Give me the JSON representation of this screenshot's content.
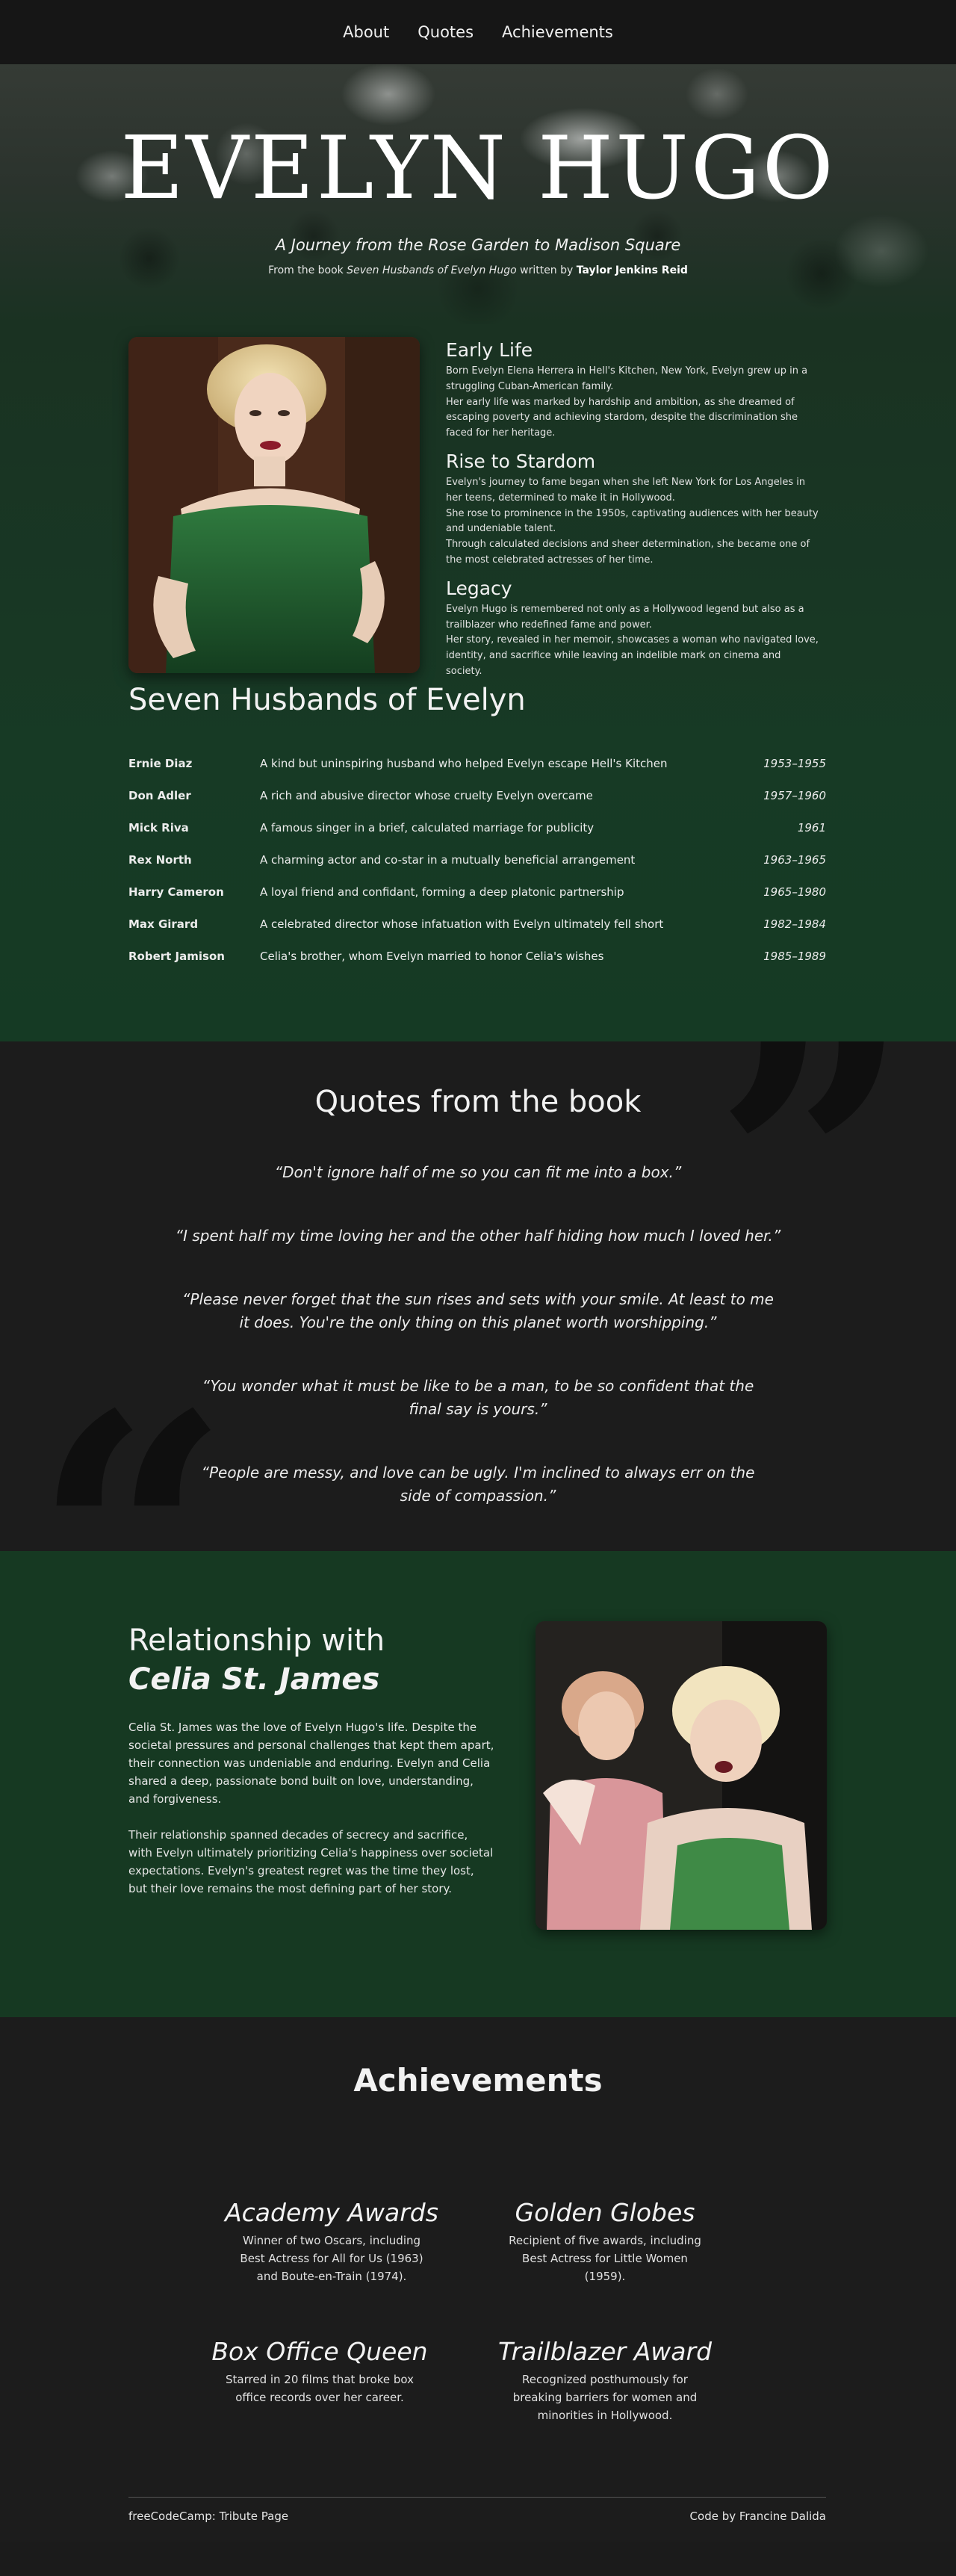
{
  "nav": {
    "items": [
      "About",
      "Quotes",
      "Achievements"
    ]
  },
  "hero": {
    "title": "EVELYN HUGO",
    "subtitle": "A Journey from the Rose Garden to Madison Square",
    "credit_prefix": "From the book ",
    "credit_book": "Seven Husbands of Evelyn Hugo",
    "credit_mid": " written by ",
    "credit_author": "Taylor Jenkins Reid"
  },
  "bio": {
    "sections": [
      {
        "heading": "Early Life",
        "paragraphs": [
          "Born Evelyn Elena Herrera in Hell's Kitchen, New York, Evelyn grew up in a struggling Cuban-American family.",
          "Her early life was marked by hardship and ambition, as she dreamed of escaping poverty and achieving stardom, despite the discrimination she faced for her heritage."
        ]
      },
      {
        "heading": "Rise to Stardom",
        "paragraphs": [
          "Evelyn's journey to fame began when she left New York for Los Angeles in her teens, determined to make it in Hollywood.",
          "She rose to prominence in the 1950s, captivating audiences with her beauty and undeniable talent.",
          "Through calculated decisions and sheer determination, she became one of the most celebrated actresses of her time."
        ]
      },
      {
        "heading": "Legacy",
        "paragraphs": [
          "Evelyn Hugo is remembered not only as a Hollywood legend but also as a trailblazer who redefined fame and power.",
          "Her story, revealed in her memoir, showcases a woman who navigated love, identity, and sacrifice while leaving an indelible mark on cinema and society."
        ]
      }
    ]
  },
  "husbands": {
    "title": "Seven Husbands of Evelyn",
    "rows": [
      {
        "name": "Ernie Diaz",
        "desc": "A kind but uninspiring husband who helped Evelyn escape Hell's Kitchen",
        "years": "1953–1955"
      },
      {
        "name": "Don Adler",
        "desc": "A rich and abusive director whose cruelty Evelyn overcame",
        "years": "1957–1960"
      },
      {
        "name": "Mick Riva",
        "desc": "A famous singer in a brief, calculated marriage for publicity",
        "years": "1961"
      },
      {
        "name": "Rex North",
        "desc": "A charming actor and co-star in a mutually beneficial arrangement",
        "years": "1963–1965"
      },
      {
        "name": "Harry Cameron",
        "desc": "A loyal friend and confidant, forming a deep platonic partnership",
        "years": "1965–1980"
      },
      {
        "name": "Max Girard",
        "desc": "A celebrated director whose infatuation with Evelyn ultimately fell short",
        "years": "1982–1984"
      },
      {
        "name": "Robert Jamison",
        "desc": "Celia's brother, whom Evelyn married to honor Celia's wishes",
        "years": "1985–1989"
      }
    ]
  },
  "quotes": {
    "title": "Quotes from the book",
    "items": [
      "“Don't ignore half of me so you can fit me into a box.”",
      "“I spent half my time loving her and the other half hiding how much I loved her.”",
      "“Please never forget that the sun rises and sets with your smile. At least to me it does. You're the only thing on this planet worth worshipping.”",
      "“You wonder what it must be like to be a man, to be so confident that the final say is yours.”",
      "“People are messy, and love can be ugly. I'm inclined to always err on the side of compassion.”"
    ]
  },
  "celia": {
    "heading_line1": "Relationship with",
    "heading_line2": "Celia St. James",
    "paragraphs": [
      "Celia St. James was the love of Evelyn Hugo's life. Despite the societal pressures and personal challenges that kept them apart, their connection was undeniable and enduring. Evelyn and Celia shared a deep, passionate bond built on love, understanding, and forgiveness.",
      "Their relationship spanned decades of secrecy and sacrifice, with Evelyn ultimately prioritizing Celia's happiness over societal expectations. Evelyn's greatest regret was the time they lost, but their love remains the most defining part of her story."
    ]
  },
  "achievements": {
    "title": "Achievements",
    "items": [
      {
        "title": "Academy Awards",
        "desc": "Winner of two Oscars, including Best Actress for All for Us (1963) and Boute-en-Train (1974)."
      },
      {
        "title": "Golden Globes",
        "desc": "Recipient of five awards, including Best Actress for Little Women (1959)."
      },
      {
        "title": "Box Office Queen",
        "desc": "Starred in 20 films that broke box office records over her career."
      },
      {
        "title": "Trailblazer Award",
        "desc": "Recognized posthumously for breaking barriers for women and minorities in Hollywood."
      }
    ]
  },
  "footer": {
    "left": "freeCodeCamp: Tribute Page",
    "right": "Code by Francine Dalida"
  }
}
